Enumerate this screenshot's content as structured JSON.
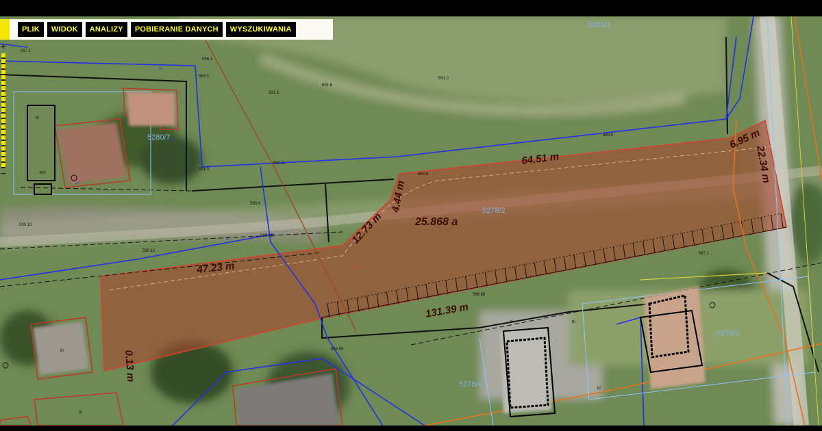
{
  "menu": {
    "items": [
      {
        "label": "PLIK"
      },
      {
        "label": "WIDOK"
      },
      {
        "label": "ANALIZY"
      },
      {
        "label": "POBIERANIE DANYCH"
      },
      {
        "label": "WYSZUKIWANIA"
      }
    ]
  },
  "zoom": {
    "in_label": "+",
    "out_label": "−"
  },
  "map": {
    "highlight_color": "#c0503a",
    "measurements": {
      "top_edge": "64.51 m",
      "northeast_edge": "6.95 m",
      "east_edge": "22.34 m",
      "south_edge": "131.39 m",
      "west_top_edge": "47.23 m",
      "diagonal_edge": "12.73 m",
      "short_edge": "4.44 m",
      "west_edge": "0.13 m"
    },
    "area": "25.868 a",
    "parcel_numbers": {
      "main": "5278/2",
      "southeast": "5278/2",
      "south": "5278/4",
      "north": "5281/1",
      "northwest": "5280/7"
    },
    "parcel_small_label": "5278",
    "building_marks": [
      "bi",
      "bl",
      "bi",
      "bi",
      "bi",
      "bi",
      "bi",
      "b"
    ],
    "elevation_labels": [
      "597.1",
      "596.1",
      "593.5",
      "591.5",
      "591.6",
      "591.2",
      "591.3",
      "590.4",
      "592.11",
      "590.12",
      "590.13",
      "589.61",
      "589.55",
      "588.88",
      "587.1",
      "589.6",
      "588.6"
    ],
    "utility_label": "w"
  }
}
